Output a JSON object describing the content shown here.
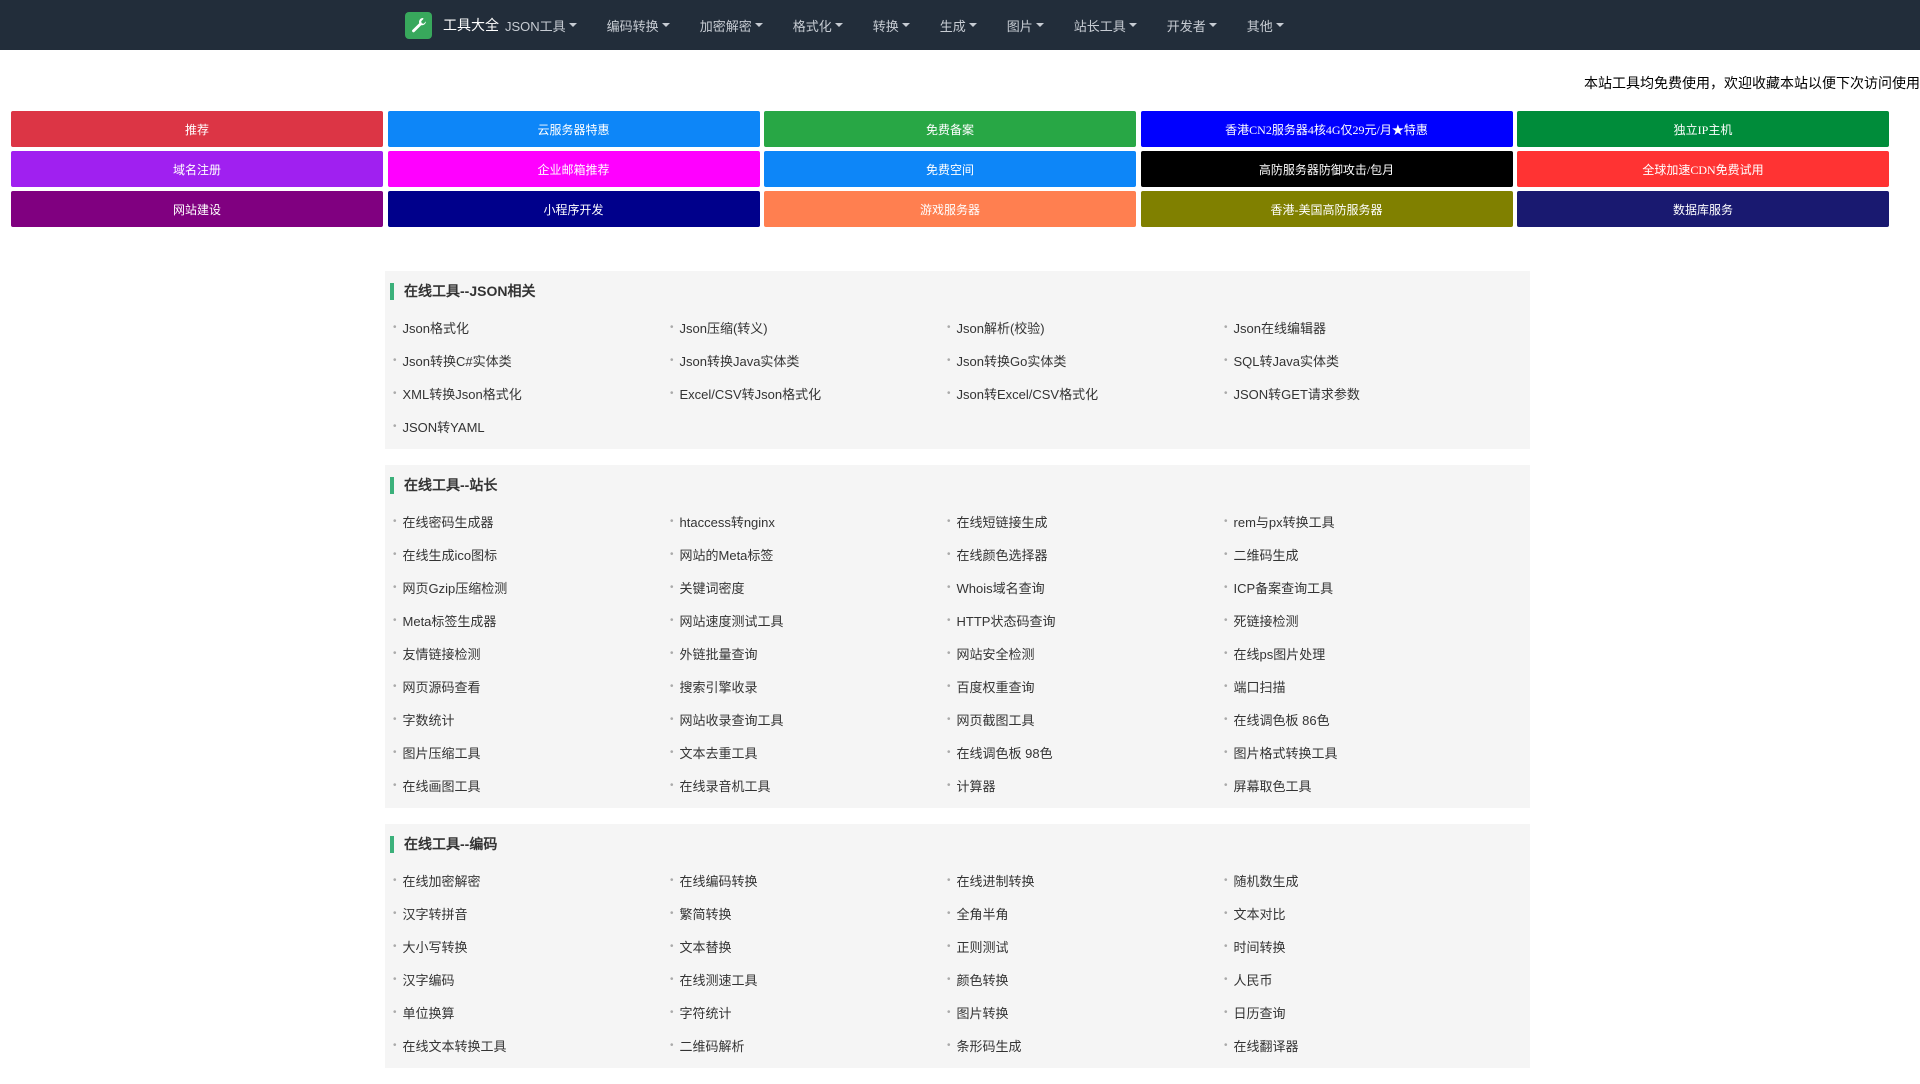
{
  "nav": {
    "brand": "工具大全",
    "menu": [
      "JSON工具",
      "编码转换",
      "加密解密",
      "格式化",
      "转换",
      "生成",
      "图片",
      "站长工具",
      "开发者",
      "其他"
    ]
  },
  "marquee": "本站工具均免费使用，欢迎收藏本站以便下次访问使用",
  "promo_buttons": [
    {
      "label": "推荐",
      "color": "#dc3545"
    },
    {
      "label": "云服务器特惠",
      "color": "#0d86f8"
    },
    {
      "label": "免费备案",
      "color": "#28a745"
    },
    {
      "label": "香港CN2服务器4核4G仅29元/月★特惠",
      "color": "#0000ff"
    },
    {
      "label": "独立IP主机",
      "color": "#008c3a"
    },
    {
      "label": "域名注册",
      "color": "#a020f0"
    },
    {
      "label": "企业邮箱推荐",
      "color": "#ff00ff"
    },
    {
      "label": "免费空间",
      "color": "#0d86f8"
    },
    {
      "label": "高防服务器防御攻击/包月",
      "color": "#000000"
    },
    {
      "label": "全球加速CDN免费试用",
      "color": "#ff3333"
    },
    {
      "label": "网站建设",
      "color": "#800080"
    },
    {
      "label": "小程序开发",
      "color": "#00008b"
    },
    {
      "label": "游戏服务器",
      "color": "#ff7f50"
    },
    {
      "label": "香港-美国高防服务器",
      "color": "#808000"
    },
    {
      "label": "数据库服务",
      "color": "#191970"
    }
  ],
  "sections": [
    {
      "title": "在线工具--JSON相关",
      "items": [
        "Json格式化",
        "Json压缩(转义)",
        "Json解析(校验)",
        "Json在线编辑器",
        "Json转换C#实体类",
        "Json转换Java实体类",
        "Json转换Go实体类",
        "SQL转Java实体类",
        "XML转换Json格式化",
        "Excel/CSV转Json格式化",
        "Json转Excel/CSV格式化",
        "JSON转GET请求参数",
        "JSON转YAML"
      ]
    },
    {
      "title": "在线工具--站长",
      "items": [
        "在线密码生成器",
        "htaccess转nginx",
        "在线短链接生成",
        "rem与px转换工具",
        "在线生成ico图标",
        "网站的Meta标签",
        "在线颜色选择器",
        "二维码生成",
        "网页Gzip压缩检测",
        "关键词密度",
        "Whois域名查询",
        "ICP备案查询工具",
        "Meta标签生成器",
        "网站速度测试工具",
        "HTTP状态码查询",
        "死链接检测",
        "友情链接检测",
        "外链批量查询",
        "网站安全检测",
        "在线ps图片处理",
        "网页源码查看",
        "搜索引擎收录",
        "百度权重查询",
        "端口扫描",
        "字数统计",
        "网站收录查询工具",
        "网页截图工具",
        "在线调色板 86色",
        "图片压缩工具",
        "文本去重工具",
        "在线调色板 98色",
        "图片格式转换工具",
        "在线画图工具",
        "在线录音机工具",
        "计算器",
        "屏幕取色工具"
      ]
    },
    {
      "title": "在线工具--编码",
      "items": [
        "在线加密解密",
        "在线编码转换",
        "在线进制转换",
        "随机数生成",
        "汉字转拼音",
        "繁简转换",
        "全角半角",
        "文本对比",
        "大小写转换",
        "文本替换",
        "正则测试",
        "时间转换",
        "汉字编码",
        "在线测速工具",
        "颜色转换",
        "人民币",
        "单位换算",
        "字符统计",
        "图片转换",
        "日历查询",
        "在线文本转换工具",
        "二维码解析",
        "条形码生成",
        "在线翻译器"
      ]
    }
  ]
}
